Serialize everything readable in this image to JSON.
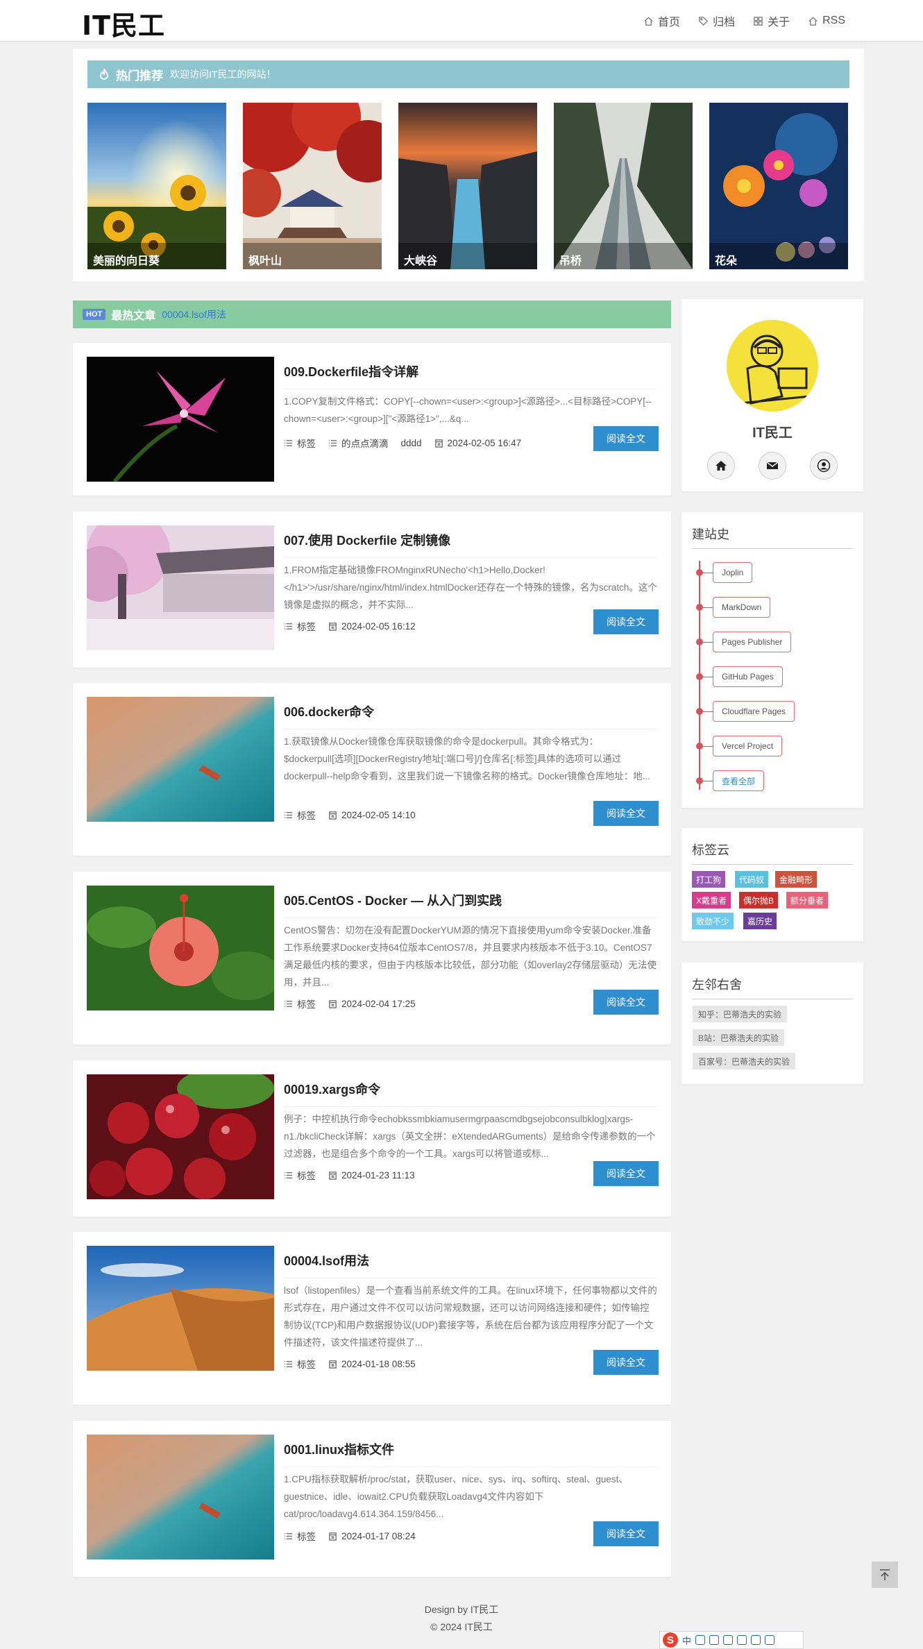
{
  "header": {
    "logo": "IT民工",
    "nav": [
      {
        "label": "首页",
        "icon": "home-icon"
      },
      {
        "label": "归档",
        "icon": "tag-icon"
      },
      {
        "label": "关于",
        "icon": "grid-icon"
      },
      {
        "label": "RSS",
        "icon": "rss-home-icon"
      }
    ]
  },
  "featured": {
    "title": "热门推荐",
    "subtitle": "欢迎访问IT民工的网站！",
    "items": [
      {
        "caption": "美丽的向日葵"
      },
      {
        "caption": "枫叶山"
      },
      {
        "caption": "大峡谷"
      },
      {
        "caption": "吊桥"
      },
      {
        "caption": "花朵"
      }
    ]
  },
  "hot": {
    "badge": "HOT",
    "title": "最热文章",
    "link": "00004.lsof用法"
  },
  "articles": [
    {
      "title": "009.Dockerfile指令详解",
      "excerpt": "1.COPY复制文件格式：COPY[--chown=<user>:<group>]<源路径>...<目标路径>COPY[--chown=<user>:<group>][\"<源路径1>\",...&q...",
      "meta": [
        {
          "icon": "list-icon",
          "text": "标签"
        },
        {
          "icon": "list-icon",
          "text": "的点点滴滴"
        },
        {
          "icon": "none",
          "text": "dddd"
        },
        {
          "icon": "calendar-icon",
          "text": "2024-02-05 16:47"
        }
      ],
      "button": "阅读全文"
    },
    {
      "title": "007.使用 Dockerfile 定制镜像",
      "excerpt": "1.FROM指定基础镜像FROMnginxRUNecho'<h1>Hello,Docker!</h1>'>/usr/share/nginx/html/index.htmlDocker还存在一个特殊的镜像，名为scratch。这个镜像是虚拟的概念，并不实际...",
      "meta": [
        {
          "icon": "list-icon",
          "text": "标签"
        },
        {
          "icon": "calendar-icon",
          "text": "2024-02-05 16:12"
        }
      ],
      "button": "阅读全文"
    },
    {
      "title": "006.docker命令",
      "excerpt": "1.获取镜像从Docker镜像仓库获取镜像的命令是dockerpull。其命令格式为：$dockerpull[选项][DockerRegistry地址[:端口号]/]仓库名[:标签]具体的选项可以通过dockerpull--help命令看到，这里我们说一下镜像名称的格式。Docker镜像仓库地址：地...",
      "meta": [
        {
          "icon": "list-icon",
          "text": "标签"
        },
        {
          "icon": "calendar-icon",
          "text": "2024-02-05 14:10"
        }
      ],
      "button": "阅读全文"
    },
    {
      "title": "005.CentOS - Docker — 从入门到实践",
      "excerpt": "CentOS警告：切勿在没有配置DockerYUM源的情况下直接使用yum命令安装Docker.准备工作系统要求Docker支持64位版本CentOS7/8，并且要求内核版本不低于3.10。CentOS7满足最低内核的要求，但由于内核版本比较低，部分功能（如overlay2存储层驱动）无法使用，并且...",
      "meta": [
        {
          "icon": "list-icon",
          "text": "标签"
        },
        {
          "icon": "calendar-icon",
          "text": "2024-02-04 17:25"
        }
      ],
      "button": "阅读全文"
    },
    {
      "title": "00019.xargs命令",
      "excerpt": "例子：中控机执行命令echobkssmbkiamusermgrpaascmdbgsejobconsulbklog|xargs-n1./bkcliCheck详解：xargs（英文全拼：eXtendedARGuments）是给命令传递参数的一个过滤器，也是组合多个命令的一个工具。xargs可以将管道或标...",
      "meta": [
        {
          "icon": "list-icon",
          "text": "标签"
        },
        {
          "icon": "calendar-icon",
          "text": "2024-01-23 11:13"
        }
      ],
      "button": "阅读全文"
    },
    {
      "title": "00004.lsof用法",
      "excerpt": "lsof（listopenfiles）是一个查看当前系统文件的工具。在linux环境下，任何事物都以文件的形式存在，用户通过文件不仅可以访问常规数据，还可以访问网络连接和硬件；如传输控制协议(TCP)和用户数据报协议(UDP)套接字等，系统在后台都为该应用程序分配了一个文件描述符，该文件描述符提供了...",
      "meta": [
        {
          "icon": "list-icon",
          "text": "标签"
        },
        {
          "icon": "calendar-icon",
          "text": "2024-01-18 08:55"
        }
      ],
      "button": "阅读全文"
    },
    {
      "title": "0001.linux指标文件",
      "excerpt": "1.CPU指标获取解析/proc/stat，获取user、nice、sys、irq、softirq、steal、guest、guestnice、idle、iowait2.CPU负载获取Loadavg4文件内容如下cat/proc/loadavg4.614.364.159/8456...",
      "meta": [
        {
          "icon": "list-icon",
          "text": "标签"
        },
        {
          "icon": "calendar-icon",
          "text": "2024-01-17 08:24"
        }
      ],
      "button": "阅读全文"
    }
  ],
  "profile": {
    "name": "IT民工",
    "icons": [
      "home-icon",
      "mail-icon",
      "user-icon"
    ]
  },
  "history": {
    "title": "建站史",
    "items": [
      "Joplin",
      "MarkDown",
      "Pages Publisher",
      "GitHub Pages",
      "Cloudflare Pages",
      "Vercel Project",
      "查看全部"
    ]
  },
  "tagcloud": {
    "title": "标签云",
    "tags": [
      {
        "label": "打工狗",
        "color": "#9b59b6"
      },
      {
        "label": "代码奴",
        "color": "#5bc0de"
      },
      {
        "label": "金融畸形",
        "color": "#c9553e"
      },
      {
        "label": "X戴重者",
        "color": "#d93a8c"
      },
      {
        "label": "偶尔抛B",
        "color": "#c9302c"
      },
      {
        "label": "额分垂者",
        "color": "#e8627a"
      },
      {
        "label": "致劲不少",
        "color": "#6ec9ec"
      },
      {
        "label": "嘉历史",
        "color": "#6a3d9a"
      }
    ]
  },
  "friends": {
    "title": "左邻右舍",
    "items": [
      "知乎：巴蒂浩夫的实验",
      "B站：巴蒂浩夫的实验",
      "百家号：巴蒂浩夫的实验"
    ]
  },
  "footer": {
    "line1": "Design by IT民工",
    "line2": "© 2024 IT民工"
  },
  "ime": {
    "logo": "S",
    "text": "中"
  }
}
